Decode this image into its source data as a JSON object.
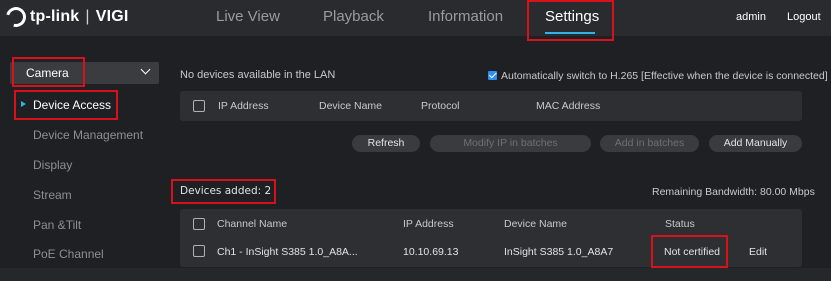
{
  "header": {
    "brand": "tp-link",
    "product": "VIGI",
    "nav": [
      "Live View",
      "Playback",
      "Information",
      "Settings"
    ],
    "active_nav": "Settings",
    "user": "admin",
    "logout": "Logout"
  },
  "sidebar": {
    "category": "Camera",
    "items": [
      "Device Access",
      "Device Management",
      "Display",
      "Stream",
      "Pan &Tilt",
      "PoE Channel"
    ],
    "active_item": "Device Access"
  },
  "lan": {
    "status": "No devices available in the LAN",
    "auto_switch_label": "Automatically switch to H.265 [Effective when the device is connected]",
    "auto_switch_checked": true,
    "columns": [
      "IP Address",
      "Device Name",
      "Protocol",
      "MAC Address"
    ]
  },
  "actions": {
    "refresh": "Refresh",
    "modify_ip": "Modify IP in batches",
    "add_batches": "Add in batches",
    "add_manually": "Add Manually"
  },
  "added": {
    "title": "Devices added: 2",
    "bandwidth": "Remaining Bandwidth: 80.00 Mbps",
    "columns": [
      "Channel Name",
      "IP Address",
      "Device Name",
      "Status"
    ],
    "rows": [
      {
        "channel": "Ch1 - InSight S385 1.0_A8A...",
        "ip": "10.10.69.13",
        "device": "InSight S385 1.0_A8A7",
        "status": "Not certified",
        "action": "Edit"
      }
    ]
  },
  "colors": {
    "accent": "#2fb4e8",
    "highlight": "#d8111b",
    "background": "#1f2023",
    "panel": "#2e2f33"
  }
}
